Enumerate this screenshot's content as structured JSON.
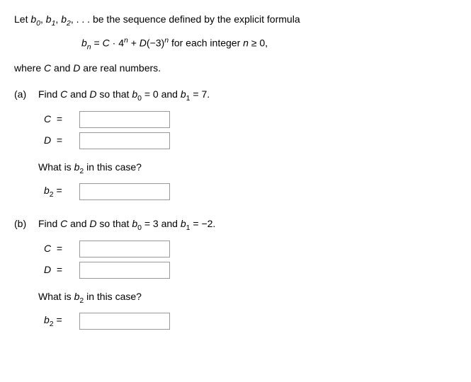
{
  "intro": {
    "prefix": "Let ",
    "seq": "b",
    "rest": " be the sequence defined by the explicit formula"
  },
  "formula": {
    "lhs_var": "b",
    "lhs_sub": "n",
    "eq": " = ",
    "c": "C",
    "dot": " · ",
    "base1": "4",
    "exp1": "n",
    "plus": " + ",
    "d": "D",
    "base2": "(−3)",
    "exp2": "n",
    "tail": " for each integer ",
    "cond_var": "n",
    "cond": " ≥ 0,"
  },
  "where": "where C and D are real numbers.",
  "parts": {
    "a": {
      "label": "(a)",
      "question_prefix": "Find ",
      "c": "C",
      "and": " and ",
      "d": "D",
      "so_that": " so that ",
      "b0_var": "b",
      "b0_sub": "0",
      "b0_val": " = 0 and ",
      "b1_var": "b",
      "b1_sub": "1",
      "b1_val": " = 7.",
      "c_label": "C  =",
      "d_label": "D  =",
      "subq_prefix": "What is ",
      "subq_var": "b",
      "subq_sub": "2",
      "subq_tail": " in this case?",
      "b2_label_var": "b",
      "b2_label_sub": "2",
      "b2_label_eq": " ="
    },
    "b": {
      "label": "(b)",
      "question_prefix": "Find ",
      "c": "C",
      "and": " and ",
      "d": "D",
      "so_that": " so that ",
      "b0_var": "b",
      "b0_sub": "0",
      "b0_val": " = 3 and ",
      "b1_var": "b",
      "b1_sub": "1",
      "b1_val": " = −2.",
      "c_label": "C  =",
      "d_label": "D  =",
      "subq_prefix": "What is ",
      "subq_var": "b",
      "subq_sub": "2",
      "subq_tail": " in this case?",
      "b2_label_var": "b",
      "b2_label_sub": "2",
      "b2_label_eq": " ="
    }
  }
}
